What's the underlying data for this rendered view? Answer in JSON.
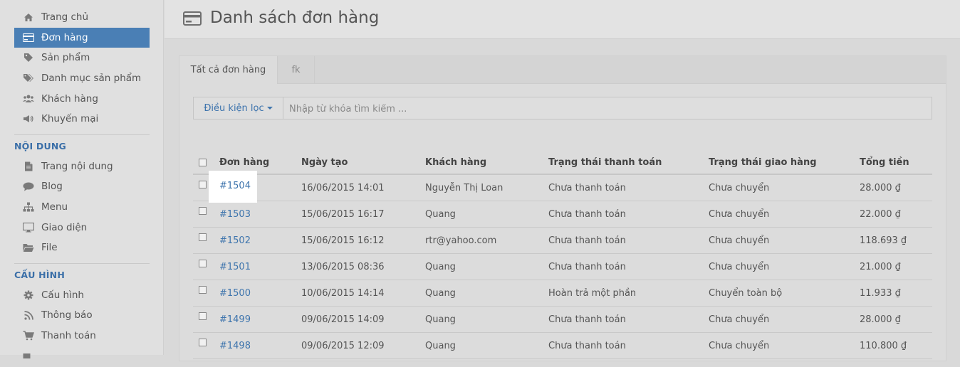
{
  "sidebar": {
    "items": [
      {
        "label": "Trang chủ",
        "icon": "home-icon"
      },
      {
        "label": "Đơn hàng",
        "icon": "credit-card-icon",
        "active": true
      },
      {
        "label": "Sản phẩm",
        "icon": "tag-icon"
      },
      {
        "label": "Danh mục sản phẩm",
        "icon": "tags-icon"
      },
      {
        "label": "Khách hàng",
        "icon": "users-icon"
      },
      {
        "label": "Khuyến mại",
        "icon": "megaphone-icon"
      }
    ],
    "content_title": "NỘI DUNG",
    "content_items": [
      {
        "label": "Trang nội dung",
        "icon": "file-icon"
      },
      {
        "label": "Blog",
        "icon": "comment-icon"
      },
      {
        "label": "Menu",
        "icon": "sitemap-icon"
      },
      {
        "label": "Giao diện",
        "icon": "monitor-icon"
      },
      {
        "label": "File",
        "icon": "folder-icon"
      }
    ],
    "config_title": "CẤU HÌNH",
    "config_items": [
      {
        "label": "Cấu hình",
        "icon": "gear-icon"
      },
      {
        "label": "Thông báo",
        "icon": "rss-icon"
      },
      {
        "label": "Thanh toán",
        "icon": "cart-icon"
      }
    ]
  },
  "header": {
    "title": "Danh sách đơn hàng",
    "icon": "credit-card-icon"
  },
  "tabs": [
    {
      "label": "Tất cả đơn hàng",
      "active": true
    },
    {
      "label": "fk",
      "active": false
    }
  ],
  "filter": {
    "button_label": "Điều kiện lọc",
    "search_placeholder": "Nhập từ khóa tìm kiếm ..."
  },
  "table": {
    "columns": [
      "Đơn hàng",
      "Ngày tạo",
      "Khách hàng",
      "Trạng thái thanh toán",
      "Trạng thái giao hàng",
      "Tổng tiền"
    ],
    "rows": [
      {
        "order": "#1504",
        "date": "16/06/2015 14:01",
        "customer": "Nguyễn Thị Loan",
        "payment": "Chưa thanh toán",
        "shipping": "Chưa chuyển",
        "total": "28.000 ₫"
      },
      {
        "order": "#1503",
        "date": "15/06/2015 16:17",
        "customer": "Quang",
        "payment": "Chưa thanh toán",
        "shipping": "Chưa chuyển",
        "total": "22.000 ₫"
      },
      {
        "order": "#1502",
        "date": "15/06/2015 16:12",
        "customer": "rtr@yahoo.com",
        "payment": "Chưa thanh toán",
        "shipping": "Chưa chuyển",
        "total": "118.693 ₫"
      },
      {
        "order": "#1501",
        "date": "13/06/2015 08:36",
        "customer": "Quang",
        "payment": "Chưa thanh toán",
        "shipping": "Chưa chuyển",
        "total": "21.000 ₫"
      },
      {
        "order": "#1500",
        "date": "10/06/2015 14:14",
        "customer": "Quang",
        "payment": "Hoàn trả một phần",
        "shipping": "Chuyển toàn bộ",
        "total": "11.933 ₫"
      },
      {
        "order": "#1499",
        "date": "09/06/2015 14:09",
        "customer": "Quang",
        "payment": "Chưa thanh toán",
        "shipping": "Chưa chuyển",
        "total": "28.000 ₫"
      },
      {
        "order": "#1498",
        "date": "09/06/2015 12:09",
        "customer": "Quang",
        "payment": "Chưa thanh toán",
        "shipping": "Chưa chuyển",
        "total": "110.800 ₫"
      }
    ]
  },
  "colors": {
    "accent": "#4a7fb5",
    "link": "#3f75ad",
    "section": "#3b6fa8"
  }
}
